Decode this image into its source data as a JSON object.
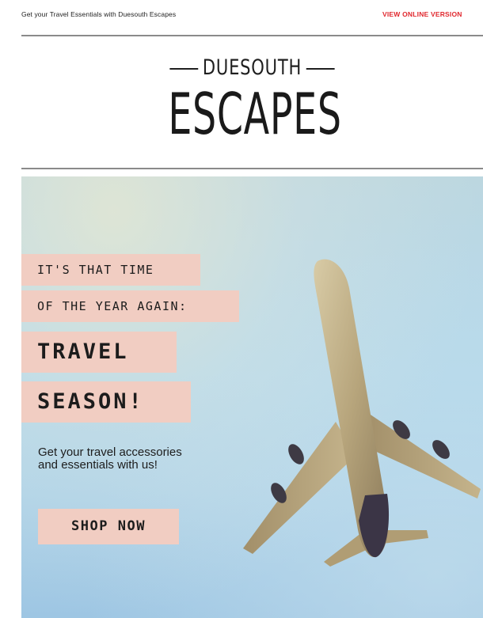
{
  "preheader": {
    "text": "Get your Travel Essentials with Duesouth Escapes",
    "view_online_label": "VIEW ONLINE VERSION"
  },
  "logo": {
    "line1": "DUESOUTH",
    "line2": "ESCAPES"
  },
  "hero": {
    "line1": "IT'S THAT TIME",
    "line2": "OF THE YEAR AGAIN:",
    "headline1": "TRAVEL",
    "headline2": "SEASON!",
    "body_line1": "Get your travel accessories",
    "body_line2": "and essentials with us!",
    "cta_label": "SHOP NOW"
  },
  "colors": {
    "accent_tag": "#f1cdc2",
    "link_red": "#e0282e",
    "sky": "#b4d8ea"
  },
  "icons": {
    "hero_image": "airplane-icon"
  }
}
